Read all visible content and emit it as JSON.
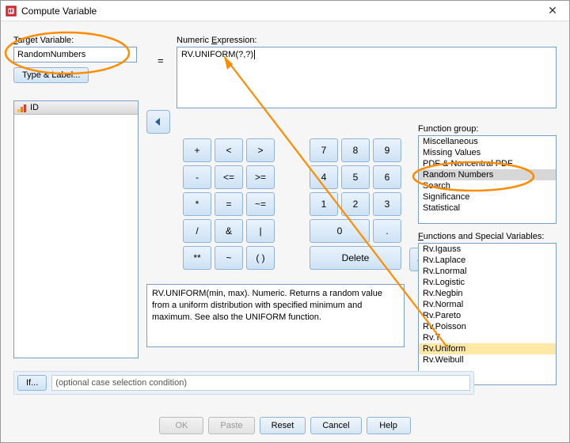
{
  "window": {
    "title": "Compute Variable"
  },
  "labels": {
    "target_variable": "Target Variable:",
    "numeric_expression": "Numeric Expression:",
    "type_and_label": "Type & Label...",
    "equals": "=",
    "function_group": "Function group:",
    "functions_vars": "Functions and Special Variables:",
    "if_btn": "If...",
    "cond_placeholder": "(optional case selection condition)"
  },
  "target_value": "RandomNumbers",
  "expression_value": "RV.UNIFORM(?,?)",
  "var_list_header": "ID",
  "keypad": {
    "r1": [
      "+",
      "<",
      ">",
      "7",
      "8",
      "9"
    ],
    "r2": [
      "-",
      "<=",
      ">=",
      "4",
      "5",
      "6"
    ],
    "r3": [
      "*",
      "=",
      "~=",
      "1",
      "2",
      "3"
    ],
    "r4": [
      "/",
      "&",
      "|",
      "0",
      "."
    ],
    "r5": [
      "**",
      "~",
      "( )",
      "Delete"
    ]
  },
  "description": "RV.UNIFORM(min, max). Numeric. Returns a random value from a uniform distribution with specified minimum and maximum. See also the UNIFORM function.",
  "function_groups": [
    "Miscellaneous",
    "Missing Values",
    "PDF & Noncentral PDF",
    "Random Numbers",
    "Search",
    "Significance",
    "Statistical"
  ],
  "function_group_selected": "Random Numbers",
  "functions": [
    "Rv.Igauss",
    "Rv.Laplace",
    "Rv.Lnormal",
    "Rv.Logistic",
    "Rv.Negbin",
    "Rv.Normal",
    "Rv.Pareto",
    "Rv.Poisson",
    "Rv.T",
    "Rv.Uniform",
    "Rv.Weibull"
  ],
  "function_selected": "Rv.Uniform",
  "buttons": {
    "ok": "OK",
    "paste": "Paste",
    "reset": "Reset",
    "cancel": "Cancel",
    "help": "Help"
  }
}
